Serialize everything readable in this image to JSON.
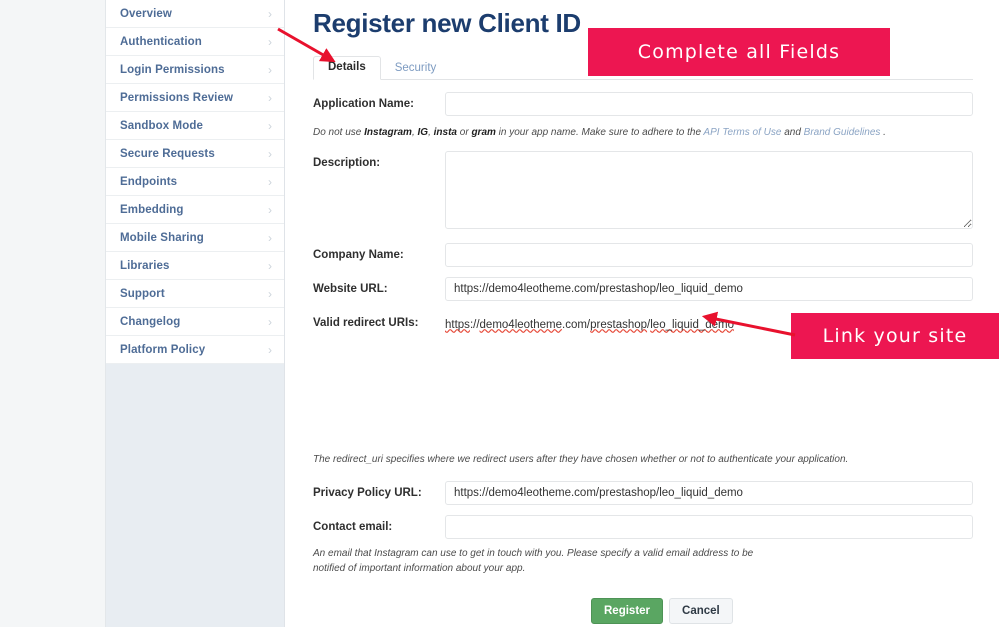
{
  "sidebar": {
    "items": [
      {
        "label": "Overview",
        "icon": "chevron-right-icon"
      },
      {
        "label": "Authentication",
        "icon": "chevron-right-icon"
      },
      {
        "label": "Login Permissions",
        "icon": "chevron-right-icon"
      },
      {
        "label": "Permissions Review",
        "icon": "chevron-right-icon"
      },
      {
        "label": "Sandbox Mode",
        "icon": "chevron-right-icon"
      },
      {
        "label": "Secure Requests",
        "icon": "chevron-right-icon"
      },
      {
        "label": "Endpoints",
        "icon": "chevron-right-icon"
      },
      {
        "label": "Embedding",
        "icon": "chevron-right-icon"
      },
      {
        "label": "Mobile Sharing",
        "icon": "chevron-right-icon"
      },
      {
        "label": "Libraries",
        "icon": "chevron-right-icon"
      },
      {
        "label": "Support",
        "icon": "chevron-right-icon"
      },
      {
        "label": "Changelog",
        "icon": "chevron-right-icon"
      },
      {
        "label": "Platform Policy",
        "icon": "chevron-right-icon"
      }
    ],
    "chevron": "›"
  },
  "header": {
    "title": "Register new Client ID"
  },
  "tabs": [
    {
      "label": "Details",
      "active": true
    },
    {
      "label": "Security",
      "active": false
    }
  ],
  "form": {
    "application_name": {
      "label": "Application Name:",
      "value": "",
      "placeholder": ""
    },
    "application_hint": {
      "t1": "Do not use ",
      "b1": "Instagram",
      "t2": ", ",
      "b2": "IG",
      "t3": ", ",
      "b3": "insta",
      "t4": " or ",
      "b4": "gram",
      "t5": " in your app name. Make sure to adhere to the ",
      "link1": "API Terms of Use",
      "t6": " and ",
      "link2": "Brand Guidelines",
      "t7": " ."
    },
    "description": {
      "label": "Description:",
      "value": "",
      "placeholder": ""
    },
    "company_name": {
      "label": "Company Name:",
      "value": "",
      "placeholder": ""
    },
    "website_url": {
      "label": "Website URL:",
      "value": "https://demo4leotheme.com/prestashop/leo_liquid_demo"
    },
    "valid_redirect_uris": {
      "label": "Valid redirect URIs:",
      "value": "https://demo4leotheme.com/prestashop/leo_liquid_demo",
      "parts": [
        "https",
        "://",
        "demo4leotheme",
        ".com/",
        "prestashop",
        "/",
        "leo_liquid_demo"
      ]
    },
    "redirect_hint": "The redirect_uri specifies where we redirect users after they have chosen whether or not to authenticate your application.",
    "privacy_policy_url": {
      "label": "Privacy Policy URL:",
      "value": "https://demo4leotheme.com/prestashop/leo_liquid_demo"
    },
    "contact_email": {
      "label": "Contact email:",
      "value": "",
      "placeholder": ""
    },
    "contact_hint": "An email that Instagram can use to get in touch with you. Please specify a valid email address to be notified of important information about your app."
  },
  "actions": {
    "register": "Register",
    "cancel": "Cancel"
  },
  "annotations": [
    {
      "text": "Complete all Fields",
      "color": "#ed1651"
    },
    {
      "text": "Link your site",
      "color": "#ed1651"
    }
  ],
  "colors": {
    "annotation_pink": "#ed1651",
    "arrow_red": "#e8112d",
    "title_blue": "#1c3d6e",
    "sidebar_link": "#4e6c96",
    "register_green": "#5aa662"
  }
}
